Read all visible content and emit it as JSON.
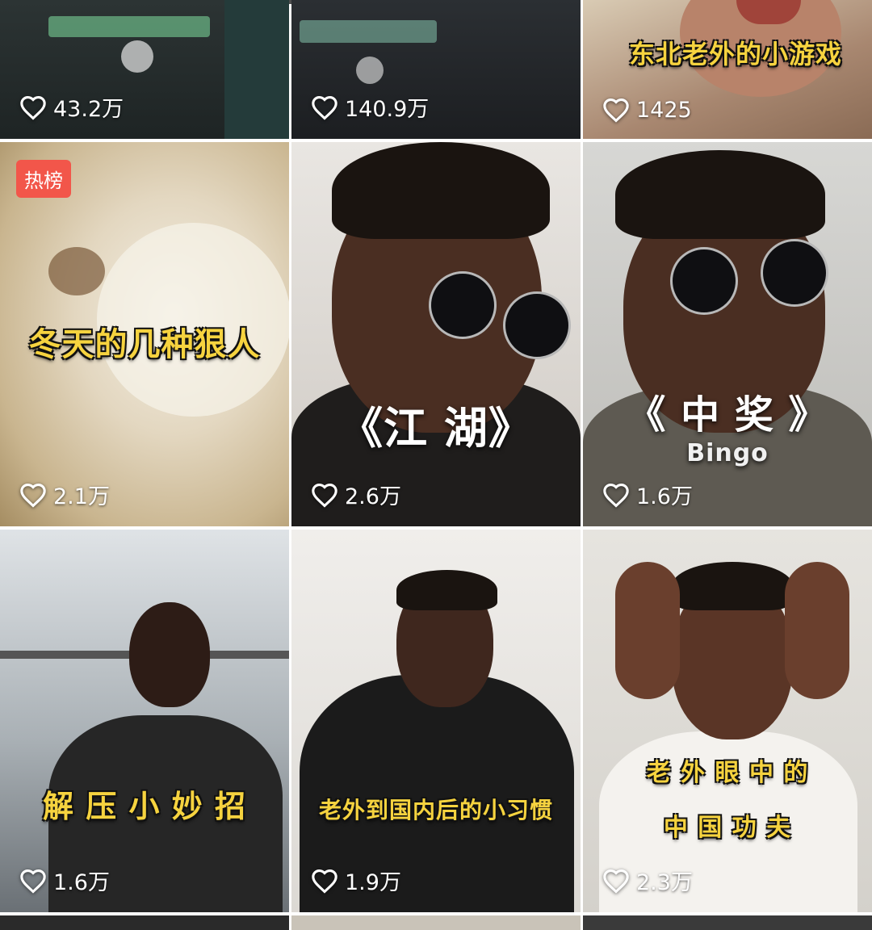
{
  "tiles": [
    {
      "likes": "43.2万",
      "caption": "",
      "badge": ""
    },
    {
      "likes": "140.9万",
      "caption": "",
      "badge": ""
    },
    {
      "likes": "1425",
      "caption": "东北老外的小游戏",
      "badge": ""
    },
    {
      "likes": "2.1万",
      "caption": "冬天的几种狠人",
      "badge": "热榜"
    },
    {
      "likes": "2.6万",
      "caption": "《江 湖》",
      "badge": ""
    },
    {
      "likes": "1.6万",
      "caption": "《 中   奖 》",
      "caption_sub": "Bingo",
      "badge": ""
    },
    {
      "likes": "1.6万",
      "caption": "解 压 小 妙 招",
      "badge": ""
    },
    {
      "likes": "1.9万",
      "caption": "老外到国内后的小习惯",
      "badge": ""
    },
    {
      "likes": "2.3万",
      "caption": "老 外 眼 中 的",
      "caption_line2": "中 国 功 夫",
      "badge": ""
    }
  ],
  "icons": {
    "like": "heart-outline-icon"
  },
  "colors": {
    "caption_yellow": "#f6d33f",
    "badge_red": "#f2564a"
  }
}
